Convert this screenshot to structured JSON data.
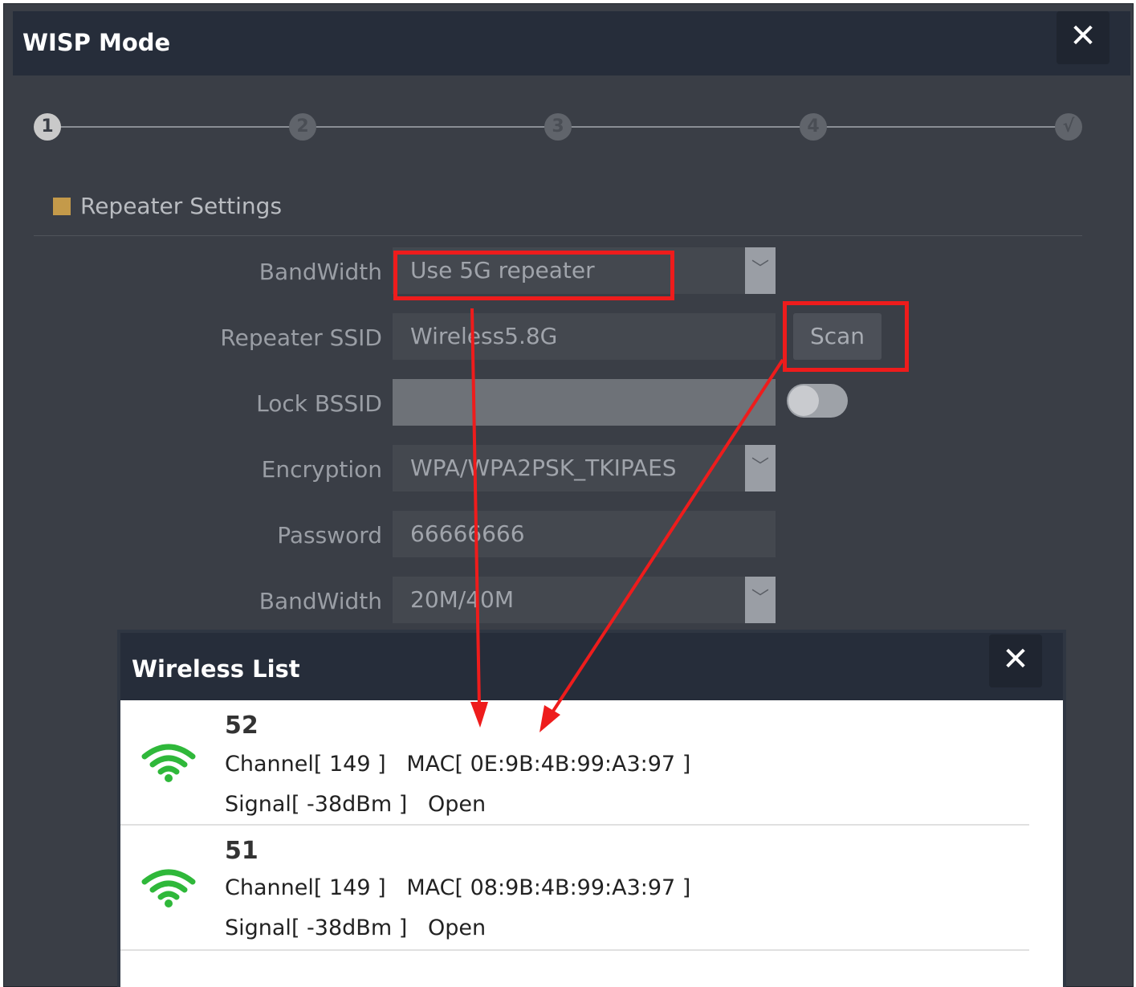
{
  "window": {
    "title": "WISP Mode",
    "close_glyph": "✕"
  },
  "stepper": {
    "steps": [
      "1",
      "2",
      "3",
      "4",
      "√"
    ],
    "active_index": 0
  },
  "section": {
    "title": "Repeater Settings"
  },
  "form": {
    "bandwidth_band": {
      "label": "BandWidth",
      "value": "Use 5G repeater",
      "arrow": "﹀"
    },
    "repeater_ssid": {
      "label": "Repeater SSID",
      "value": "Wireless5.8G"
    },
    "scan_label": "Scan",
    "lock_bssid": {
      "label": "Lock BSSID",
      "value": "",
      "toggle_on": false
    },
    "encryption": {
      "label": "Encryption",
      "value": "WPA/WPA2PSK_TKIPAES",
      "arrow": "﹀"
    },
    "password": {
      "label": "Password",
      "value": "66666666"
    },
    "bandwidth_width": {
      "label": "BandWidth",
      "value": "20M/40M",
      "arrow": "﹀"
    }
  },
  "annotation_color": "#ee1c1c",
  "wireless_list": {
    "title": "Wireless List",
    "close_glyph": "✕",
    "items": [
      {
        "ssid": "52",
        "line1": "Channel[ 149 ]   MAC[ 0E:9B:4B:99:A3:97 ]",
        "line2": "Signal[ -38dBm ]   Open",
        "icon": "wifi-signal-icon"
      },
      {
        "ssid": "51",
        "line1": "Channel[ 149 ]   MAC[ 08:9B:4B:99:A3:97 ]",
        "line2": "Signal[ -38dBm ]   Open",
        "icon": "wifi-signal-icon"
      }
    ]
  }
}
